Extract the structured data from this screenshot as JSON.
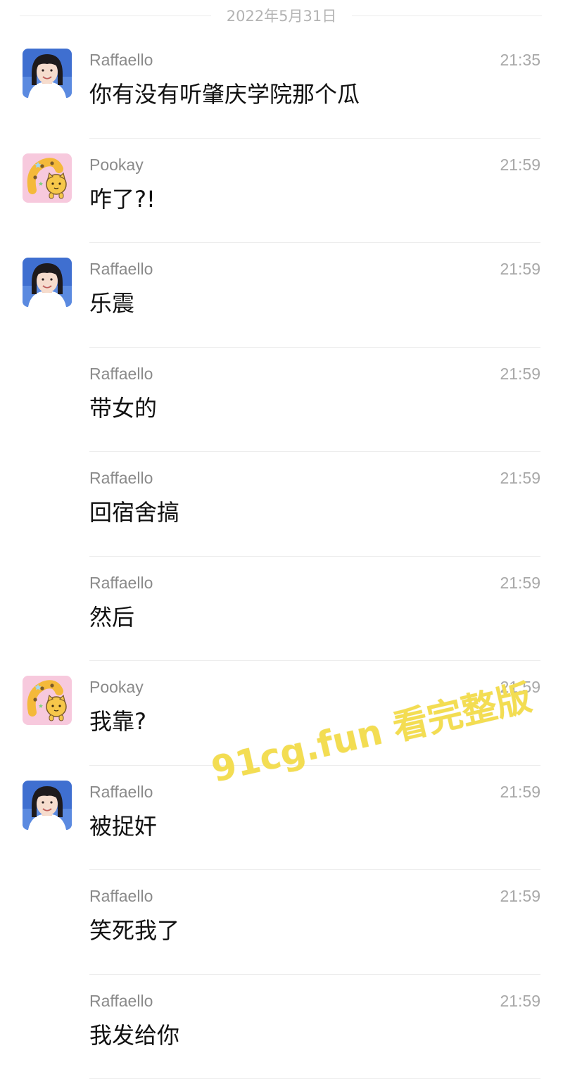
{
  "date_separator": "2022年5月31日",
  "messages": [
    {
      "sender": "Raffaello",
      "time": "21:35",
      "text": "你有没有听肇庆学院那个瓜",
      "avatar": "girl-avatar",
      "show_avatar": true
    },
    {
      "sender": "Pookay",
      "time": "21:59",
      "text": "咋了?!",
      "avatar": "cat-avatar",
      "show_avatar": true
    },
    {
      "sender": "Raffaello",
      "time": "21:59",
      "text": "乐震",
      "avatar": "girl-avatar",
      "show_avatar": true
    },
    {
      "sender": "Raffaello",
      "time": "21:59",
      "text": "带女的",
      "avatar": "girl-avatar",
      "show_avatar": false
    },
    {
      "sender": "Raffaello",
      "time": "21:59",
      "text": "回宿舍搞",
      "avatar": "girl-avatar",
      "show_avatar": false
    },
    {
      "sender": "Raffaello",
      "time": "21:59",
      "text": "然后",
      "avatar": "girl-avatar",
      "show_avatar": false
    },
    {
      "sender": "Pookay",
      "time": "21:59",
      "text": "我靠?",
      "avatar": "cat-avatar",
      "show_avatar": true
    },
    {
      "sender": "Raffaello",
      "time": "21:59",
      "text": "被捉奸",
      "avatar": "girl-avatar",
      "show_avatar": true
    },
    {
      "sender": "Raffaello",
      "time": "21:59",
      "text": "笑死我了",
      "avatar": "girl-avatar",
      "show_avatar": false
    },
    {
      "sender": "Raffaello",
      "time": "21:59",
      "text": "我发给你",
      "avatar": "girl-avatar",
      "show_avatar": false
    }
  ],
  "watermark": "91cg.fun 看完整版",
  "colors": {
    "watermark": "#f3dd52",
    "sender": "#8a8a8a",
    "time": "#a8a8a8",
    "message": "#111111",
    "divider": "#ededed"
  }
}
